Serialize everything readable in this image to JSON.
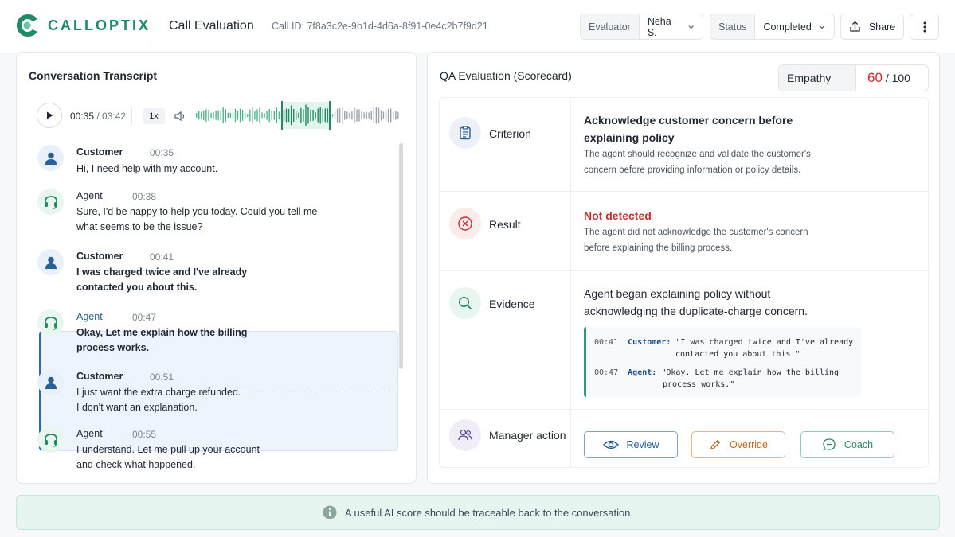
{
  "header": {
    "brand": "CALLOPTIX",
    "page_title": "Call Evaluation",
    "call_id": "Call ID: 7f8a3c2e-9b1d-4d6a-8f91-0e4c2b7f9d21",
    "evaluator_label": "Evaluator",
    "evaluator_value": "Neha S.",
    "status_label": "Status",
    "status_value": "Completed",
    "share_label": "Share"
  },
  "transcript": {
    "title": "Conversation Transcript",
    "player": {
      "current_time": "00:35",
      "separator": " / ",
      "duration": "03:42",
      "speed": "1x"
    },
    "messages": [
      {
        "speaker": "Customer",
        "time": "00:35",
        "lines": [
          "Hi, I need help with my account."
        ]
      },
      {
        "speaker": "Agent",
        "time": "00:38",
        "lines": [
          "Sure, I'd be happy to help you today. Could you tell me",
          "what seems to be the issue?"
        ]
      },
      {
        "speaker": "Customer",
        "time": "00:41",
        "lines": [
          "I was charged twice and I've already",
          "contacted you about this."
        ]
      },
      {
        "speaker": "Agent",
        "time": "00:47",
        "lines": [
          "Okay, Let me explain how the billing",
          "process works."
        ]
      },
      {
        "speaker": "Customer",
        "time": "00:51",
        "lines": [
          "I just want the extra charge refunded.",
          "I don't want an explanation."
        ]
      },
      {
        "speaker": "Agent",
        "time": "00:55",
        "lines": [
          "I understand. Let me pull up your account",
          "and check what happened."
        ]
      }
    ]
  },
  "qa": {
    "title": "QA Evaluation (Scorecard)",
    "score": {
      "label": "Empathy",
      "value": "60",
      "max": "/ 100"
    },
    "criterion": {
      "label": "Criterion",
      "heading": [
        "Acknowledge customer concern before",
        "explaining policy"
      ],
      "desc": [
        "The agent should recognize and validate the customer's",
        "concern before providing information or policy details."
      ]
    },
    "result": {
      "label": "Result",
      "heading": "Not detected",
      "desc": [
        "The agent did not acknowledge the customer's concern",
        "before explaining the billing process."
      ]
    },
    "evidence": {
      "label": "Evidence",
      "heading": [
        "Agent began explaining policy without",
        "acknowledging the duplicate-charge concern."
      ],
      "quotes": [
        {
          "time": "00:41",
          "speaker": "Customer:",
          "text": "\"I was charged twice and I've already",
          "text2": "contacted you about this.\""
        },
        {
          "time": "00:47",
          "speaker": "Agent:",
          "text": "\"Okay. Let me explain how the billing",
          "text2": "process works.\""
        }
      ]
    },
    "manager_action": {
      "label": "Manager action",
      "review": "Review",
      "override": "Override",
      "coach": "Coach"
    }
  },
  "banner": {
    "text": "A useful AI score should be traceable back to the conversation."
  },
  "colors": {
    "brand": "#1f8a64",
    "danger": "#c93030",
    "accent_blue": "#2c6bb3"
  }
}
